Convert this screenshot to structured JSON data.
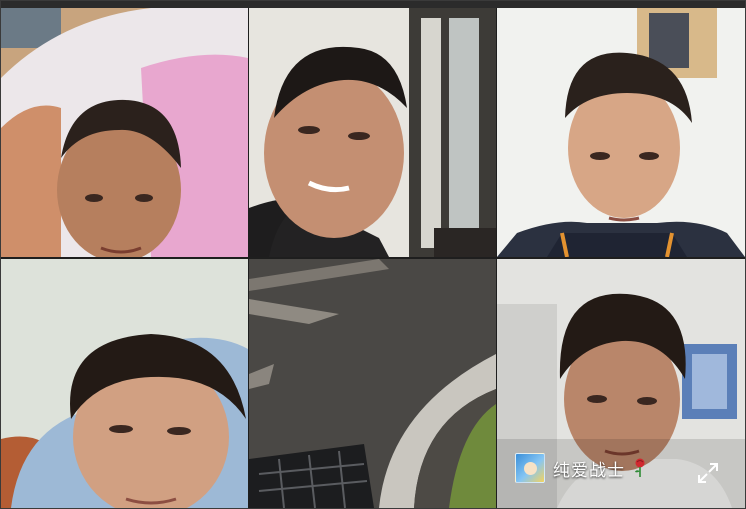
{
  "window": {
    "topbar_color": "#2b2b2b"
  },
  "participants": [
    {
      "id": 1,
      "icon": "video-feed"
    },
    {
      "id": 2,
      "icon": "video-feed"
    },
    {
      "id": 3,
      "icon": "video-feed"
    },
    {
      "id": 4,
      "icon": "video-feed"
    },
    {
      "id": 5,
      "icon": "video-feed"
    },
    {
      "id": 6,
      "icon": "video-feed",
      "name": "纯爱战士",
      "avatar_icon": "anime-avatar-icon",
      "badge_icon": "rose-icon",
      "action_icon": "expand-fullscreen-icon"
    }
  ],
  "colors": {
    "name_text": "#ffffff",
    "accent_rose": "#d0282f"
  }
}
